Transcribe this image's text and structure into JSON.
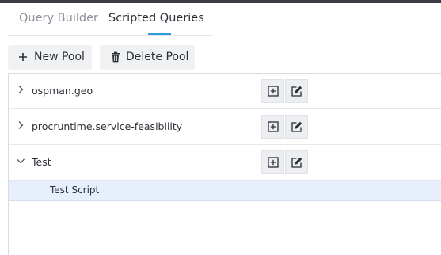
{
  "tabs": [
    {
      "label": "Query Builder",
      "active": false
    },
    {
      "label": "Scripted Queries",
      "active": true
    }
  ],
  "toolbar": {
    "new_pool_label": "New Pool",
    "new_pool_icon": "plus-icon",
    "delete_pool_label": "Delete Pool",
    "delete_pool_icon": "trash-icon"
  },
  "tree": {
    "pools": [
      {
        "label": "ospman.geo",
        "expanded": false
      },
      {
        "label": "procruntime.service-feasibility",
        "expanded": false
      },
      {
        "label": "Test",
        "expanded": true,
        "scripts": [
          {
            "label": "Test Script",
            "selected": true
          }
        ]
      }
    ],
    "row_actions": {
      "add_icon": "plus-square-icon",
      "edit_icon": "edit-icon"
    }
  },
  "colors": {
    "accent": "#2a9bd8",
    "selected_row": "#e6effb",
    "top_bar": "#3c3c46"
  }
}
